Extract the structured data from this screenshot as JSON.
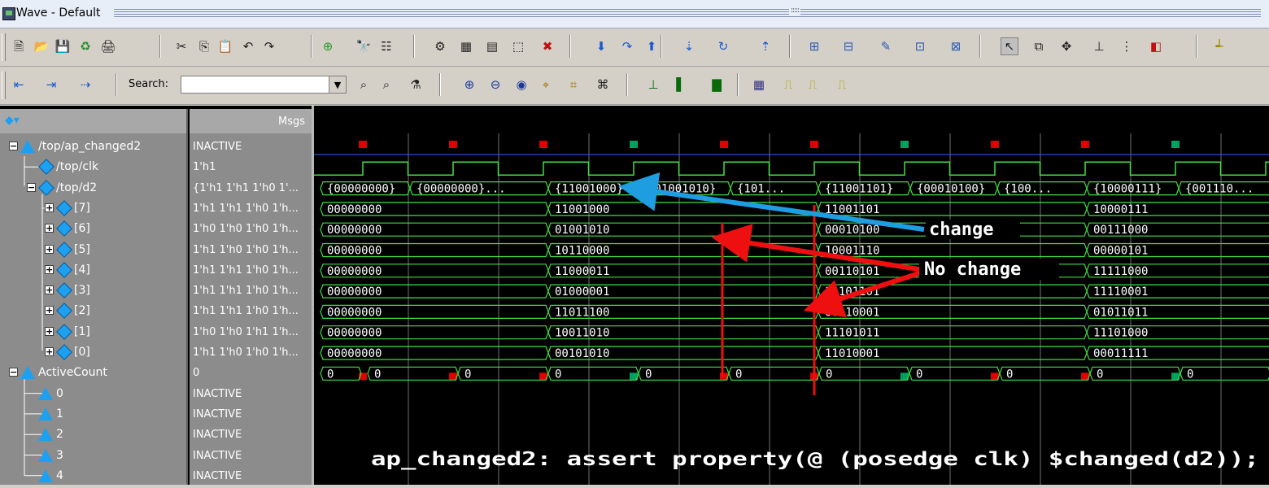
{
  "window": {
    "title": "Wave - Default",
    "grip": ":::::"
  },
  "toolbar": {
    "search_label": "Search:",
    "search_value": "",
    "icons_row1": [
      "new-icon",
      "open-icon",
      "save-icon",
      "reload-icon",
      "print-icon",
      "cut-icon",
      "copy-icon",
      "paste-icon",
      "undo-icon",
      "redo-icon",
      "add-icon",
      "find-icon",
      "format-icon",
      "step-icon",
      "run-icon",
      "memory-icon",
      "break-icon",
      "stop-icon",
      "step-into-icon",
      "step-over-icon",
      "step-out-icon",
      "step-down-icon",
      "restart-icon",
      "continue-icon",
      "wave-add-icon",
      "wave-del-icon",
      "wave-edit-icon",
      "wave-group-icon",
      "wave-insert-icon",
      "select-icon",
      "zoom-region-icon",
      "pan-icon",
      "cursor-icon",
      "grid-icon",
      "traffic-icon",
      "marker-icon"
    ],
    "icons_row2": [
      "prev-edge-icon",
      "next-edge-icon",
      "find-edge-icon",
      "search-prev-icon",
      "search-next-icon",
      "search-filter-icon",
      "zoom-in-icon",
      "zoom-out-icon",
      "zoom-full-icon",
      "zoom-cursor-icon",
      "zoom-last-icon",
      "zoom-range-icon",
      "wave-literal-icon",
      "wave-bar-icon",
      "wave-box-icon",
      "wave-grid-icon",
      "wave-edge1-icon",
      "wave-edge2-icon",
      "wave-edge3-icon"
    ]
  },
  "header": {
    "values_title": "Msgs",
    "names_icon": "signal-tree-icon"
  },
  "rows": [
    {
      "name": "/top/ap_changed2",
      "value": "INACTIVE",
      "kind": "assert",
      "expander": "−"
    },
    {
      "name": "/top/clk",
      "value": "1'h1",
      "kind": "signal"
    },
    {
      "name": "/top/d2",
      "value": "{1'h1 1'h1 1'h0 1'...",
      "kind": "signal",
      "expander": "−"
    },
    {
      "name": "[7]",
      "value": "1'h1 1'h1 1'h0 1'h...",
      "kind": "signal",
      "expander": "+"
    },
    {
      "name": "[6]",
      "value": "1'h0 1'h0 1'h0 1'h...",
      "kind": "signal",
      "expander": "+"
    },
    {
      "name": "[5]",
      "value": "1'h1 1'h0 1'h0 1'h...",
      "kind": "signal",
      "expander": "+"
    },
    {
      "name": "[4]",
      "value": "1'h1 1'h1 1'h0 1'h...",
      "kind": "signal",
      "expander": "+"
    },
    {
      "name": "[3]",
      "value": "1'h1 1'h1 1'h0 1'h...",
      "kind": "signal",
      "expander": "+"
    },
    {
      "name": "[2]",
      "value": "1'h1 1'h1 1'h0 1'h...",
      "kind": "signal",
      "expander": "+"
    },
    {
      "name": "[1]",
      "value": "1'h0 1'h0 1'h1 1'h...",
      "kind": "signal",
      "expander": "+"
    },
    {
      "name": "[0]",
      "value": "1'h1 1'h0 1'h0 1'h...",
      "kind": "signal",
      "expander": "+"
    },
    {
      "name": "ActiveCount",
      "value": "0",
      "kind": "assert",
      "expander": "−"
    },
    {
      "name": "0",
      "value": "INACTIVE",
      "kind": "assert"
    },
    {
      "name": "1",
      "value": "INACTIVE",
      "kind": "assert"
    },
    {
      "name": "2",
      "value": "INACTIVE",
      "kind": "assert"
    },
    {
      "name": "3",
      "value": "INACTIVE",
      "kind": "assert"
    },
    {
      "name": "4",
      "value": "INACTIVE",
      "kind": "assert"
    }
  ],
  "wave": {
    "d2_bus": [
      "{00000000}",
      "{00000000}...",
      "{11001000}",
      "{01001010}",
      "{101...",
      "{11001101}",
      "{00010100}",
      "{100...",
      "{10000111}",
      "{001110..."
    ],
    "bits": {
      "7": [
        "00000000",
        "11001000",
        "11001101",
        "10000111"
      ],
      "6": [
        "00000000",
        "01001010",
        "00010100",
        "00111000"
      ],
      "5": [
        "00000000",
        "10110000",
        "10001110",
        "00000101"
      ],
      "4": [
        "00000000",
        "11000011",
        "00110101",
        "11111000"
      ],
      "3": [
        "00000000",
        "01000001",
        "11101101",
        "11110001"
      ],
      "2": [
        "00000000",
        "11011100",
        "00110001",
        "01011011"
      ],
      "1": [
        "00000000",
        "10011010",
        "11101011",
        "11101000"
      ],
      "0": [
        "00000000",
        "00101010",
        "11010001",
        "00011111"
      ]
    },
    "active_count": [
      "0",
      "0",
      "0",
      "0",
      "0",
      "0",
      "0",
      "0",
      "0",
      "0",
      "0",
      "0"
    ],
    "assert_markers": [
      "fail",
      "fail",
      "fail",
      "pass",
      "fail",
      "fail",
      "pass",
      "fail",
      "fail",
      "pass"
    ],
    "annotations": {
      "change": "change",
      "no_change": "No change",
      "assertion": "ap_changed2: assert property(@ (posedge clk) $changed(d2));"
    },
    "colors": {
      "wave": "#40e040",
      "grid": "#707070",
      "fail": "#e00000",
      "pass": "#00a060",
      "blue_arrow": "#1e9ee0",
      "red_arrow": "#ee1010"
    }
  }
}
